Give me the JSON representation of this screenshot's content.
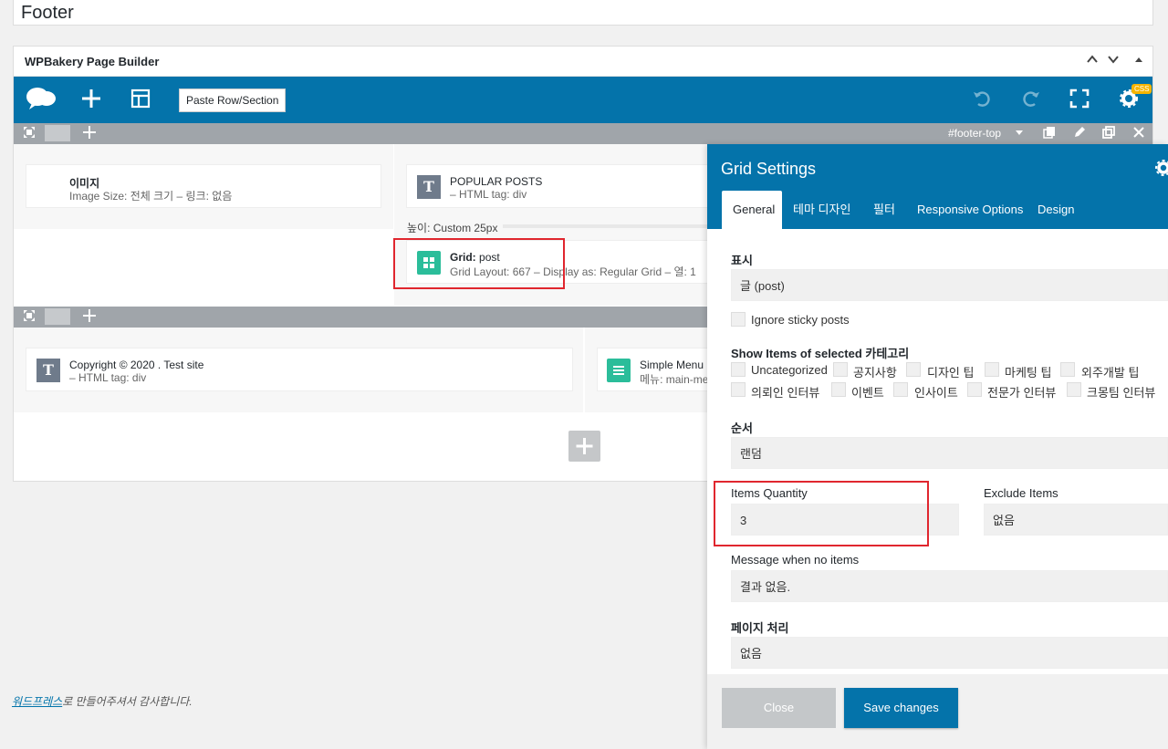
{
  "page": {
    "title_value": "Footer"
  },
  "builder": {
    "title": "WPBakery Page Builder",
    "paste_label": "Paste Row/Section",
    "css_badge": "CSS"
  },
  "row1": {
    "row_id": "#footer-top",
    "image_el": {
      "title": "이미지",
      "sub": "Image Size: 전체 크기  – 링크: 없음"
    },
    "text_el": {
      "title": "POPULAR POSTS",
      "sub": "– HTML tag: div"
    },
    "spacer_label": "높이: Custom  25px",
    "grid_el": {
      "title_bold": "Grid:",
      "title_rest": "post",
      "sub": "Grid Layout: 667  – Display as: Regular Grid  – 열: 1"
    }
  },
  "row2": {
    "text_el": {
      "title": "Copyright © 2020 . Test site",
      "sub": "– HTML tag: div"
    },
    "menu_el": {
      "title": "Simple Menu",
      "sub": "메뉴: main-menu"
    }
  },
  "panel": {
    "title": "Grid Settings",
    "tabs": [
      "General",
      "테마 디자인",
      "필터",
      "Responsive Options",
      "Design"
    ],
    "display_label": "표시",
    "display_value": "글 (post)",
    "ignore_sticky": "Ignore sticky posts",
    "show_items_label": "Show Items of selected 카테고리",
    "categories_row1": [
      "Uncategorized",
      "공지사항",
      "디자인 팁",
      "마케팅 팁",
      "외주개발 팁"
    ],
    "categories_row2": [
      "의뢰인 인터뷰",
      "이벤트",
      "인사이트",
      "전문가 인터뷰",
      "크몽팀 인터뷰"
    ],
    "order_label": "순서",
    "order_value": "랜덤",
    "items_qty_label": "Items Quantity",
    "items_qty_value": "3",
    "exclude_label": "Exclude Items",
    "exclude_value": "없음",
    "no_items_label": "Message when no items",
    "no_items_value": "결과 없음.",
    "pagination_label": "페이지 처리",
    "pagination_value": "없음",
    "close_label": "Close",
    "save_label": "Save changes"
  },
  "footer": {
    "link": "워드프레스",
    "rest": "로 만들어주셔서 감사합니다."
  }
}
